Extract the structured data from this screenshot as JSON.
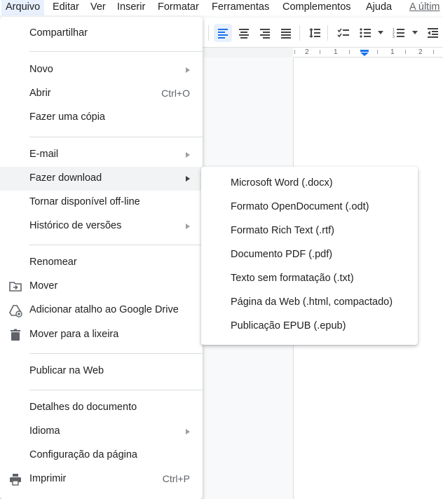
{
  "menubar": {
    "items": [
      "Arquivo",
      "Editar",
      "Ver",
      "Inserir",
      "Formatar",
      "Ferramentas",
      "Complementos",
      "Ajuda"
    ],
    "last_edit_link": "A últim"
  },
  "toolbar": {
    "icons": [
      "align-left-icon",
      "align-center-icon",
      "align-right-icon",
      "align-justify-icon",
      "line-spacing-icon",
      "checklist-icon",
      "bulleted-list-icon",
      "numbered-list-icon",
      "decrease-indent-icon"
    ]
  },
  "ruler": {
    "numbers": [
      "2",
      "1",
      "1",
      "2"
    ]
  },
  "file_menu": {
    "items": [
      {
        "label": "Compartilhar",
        "shortcut": "",
        "submenu": false,
        "icon": ""
      },
      {
        "label": "Novo",
        "shortcut": "",
        "submenu": true,
        "icon": ""
      },
      {
        "label": "Abrir",
        "shortcut": "Ctrl+O",
        "submenu": false,
        "icon": ""
      },
      {
        "label": "Fazer uma cópia",
        "shortcut": "",
        "submenu": false,
        "icon": ""
      },
      {
        "label": "E-mail",
        "shortcut": "",
        "submenu": true,
        "icon": ""
      },
      {
        "label": "Fazer download",
        "shortcut": "",
        "submenu": true,
        "icon": "",
        "highlighted": true
      },
      {
        "label": "Tornar disponível off-line",
        "shortcut": "",
        "submenu": false,
        "icon": ""
      },
      {
        "label": "Histórico de versões",
        "shortcut": "",
        "submenu": true,
        "icon": ""
      },
      {
        "label": "Renomear",
        "shortcut": "",
        "submenu": false,
        "icon": ""
      },
      {
        "label": "Mover",
        "shortcut": "",
        "submenu": false,
        "icon": "move-folder-icon"
      },
      {
        "label": "Adicionar atalho ao Google Drive",
        "shortcut": "",
        "submenu": false,
        "icon": "add-drive-shortcut-icon"
      },
      {
        "label": "Mover para a lixeira",
        "shortcut": "",
        "submenu": false,
        "icon": "trash-icon"
      },
      {
        "label": "Publicar na Web",
        "shortcut": "",
        "submenu": false,
        "icon": ""
      },
      {
        "label": "Detalhes do documento",
        "shortcut": "",
        "submenu": false,
        "icon": ""
      },
      {
        "label": "Idioma",
        "shortcut": "",
        "submenu": true,
        "icon": ""
      },
      {
        "label": "Configuração da página",
        "shortcut": "",
        "submenu": false,
        "icon": ""
      },
      {
        "label": "Imprimir",
        "shortcut": "Ctrl+P",
        "submenu": false,
        "icon": "printer-icon"
      }
    ]
  },
  "download_submenu": {
    "items": [
      "Microsoft Word (.docx)",
      "Formato OpenDocument (.odt)",
      "Formato Rich Text (.rtf)",
      "Documento PDF (.pdf)",
      "Texto sem formatação (.txt)",
      "Página da Web (.html, compactado)",
      "Publicação EPUB (.epub)"
    ]
  },
  "colors": {
    "accent": "#1a73e8",
    "highlight": "#f1f3f4",
    "active_menu": "#e8f0fe"
  }
}
